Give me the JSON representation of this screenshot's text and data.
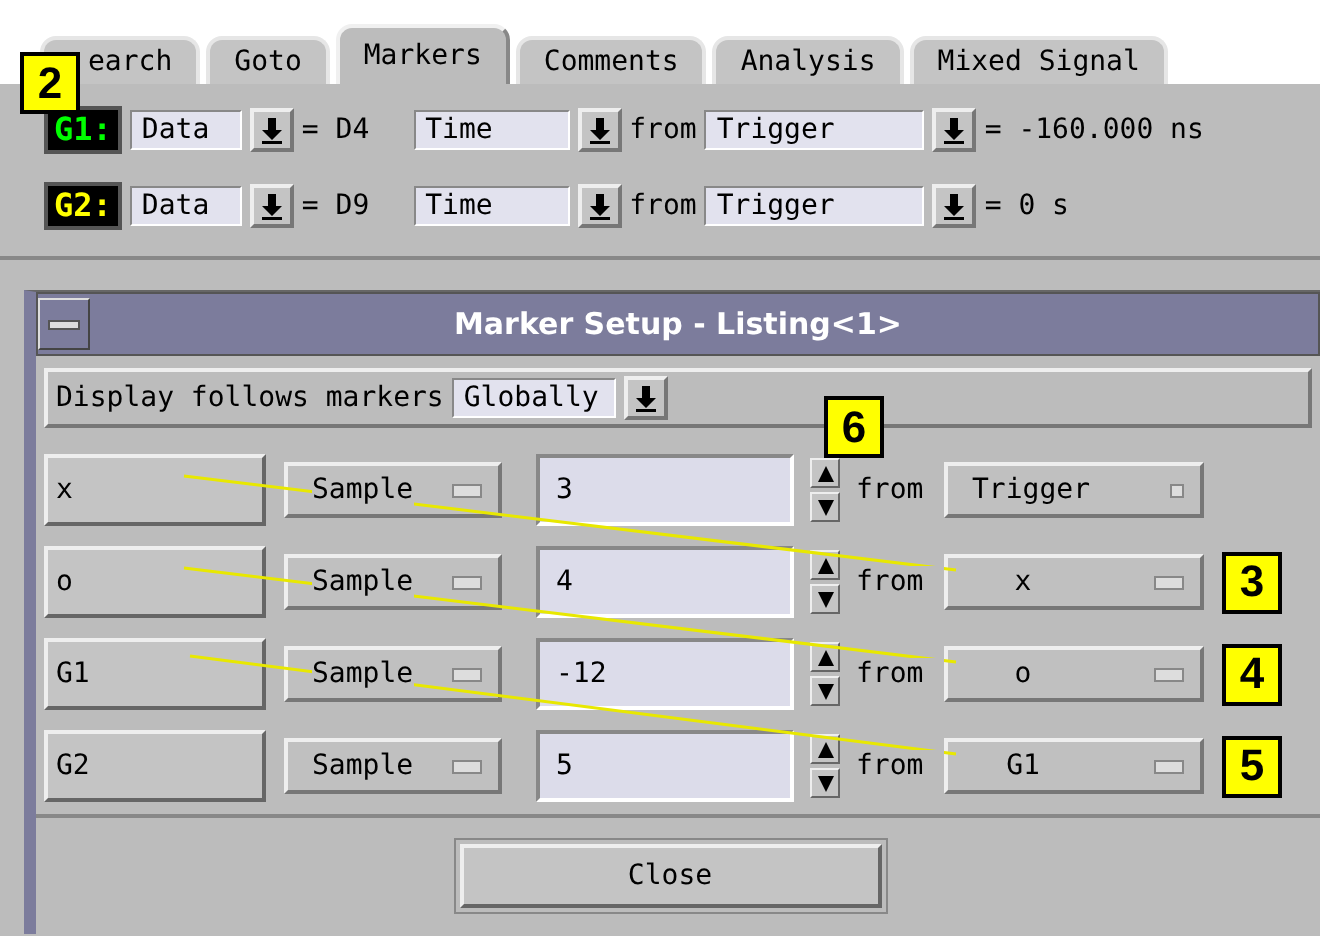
{
  "tabs": [
    {
      "label": "earch",
      "selected": false
    },
    {
      "label": "Goto",
      "selected": false
    },
    {
      "label": "Markers",
      "selected": true
    },
    {
      "label": "Comments",
      "selected": false
    },
    {
      "label": "Analysis",
      "selected": false
    },
    {
      "label": "Mixed Signal",
      "selected": false
    }
  ],
  "top_callout": "2",
  "markers": [
    {
      "name": "G1:",
      "color": "#00ff00",
      "mode": "Data",
      "value": "= D4",
      "type": "Time",
      "from_label": "from",
      "reference": "Trigger",
      "result": "= -160.000 ns"
    },
    {
      "name": "G2:",
      "color": "#ffff00",
      "mode": "Data",
      "value": "= D9",
      "type": "Time",
      "from_label": "from",
      "reference": "Trigger",
      "result": "= 0 s"
    }
  ],
  "dialog": {
    "title": "Marker Setup - Listing<1>",
    "display_label": "Display follows markers",
    "display_mode": "Globally",
    "spinner_callout": "6",
    "rows": [
      {
        "name": "x",
        "unit": "Sample",
        "value": "3",
        "from_label": "from",
        "reference": "Trigger"
      },
      {
        "name": "o",
        "unit": "Sample",
        "value": "4",
        "from_label": "from",
        "reference": "x",
        "callout": "3"
      },
      {
        "name": "G1",
        "unit": "Sample",
        "value": "-12",
        "from_label": "from",
        "reference": "o",
        "callout": "4"
      },
      {
        "name": "G2",
        "unit": "Sample",
        "value": "5",
        "from_label": "from",
        "reference": "G1",
        "callout": "5"
      }
    ],
    "close": "Close"
  }
}
